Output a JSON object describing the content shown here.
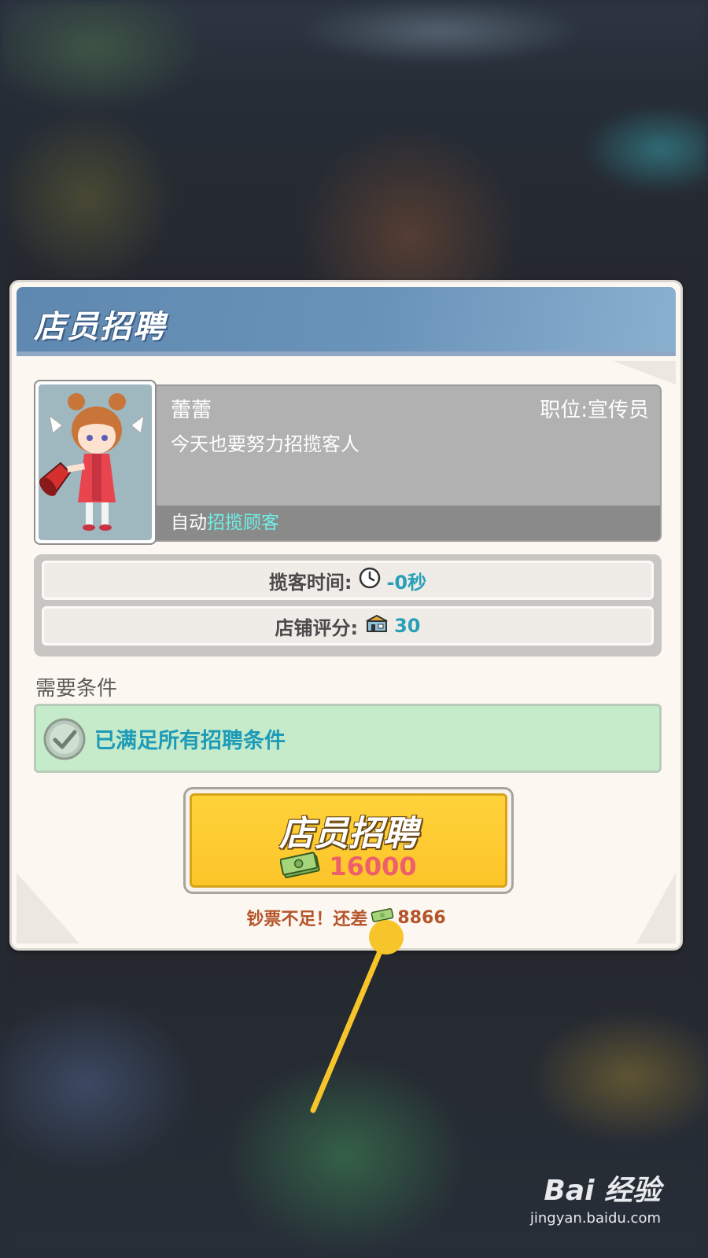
{
  "dialog": {
    "title": "店员招聘"
  },
  "employee": {
    "name": "蕾蕾",
    "position": "职位:宣传员",
    "motto": "今天也要努力招揽客人",
    "skill_prefix": "自动",
    "skill_highlight": "招揽顾客"
  },
  "stats": {
    "solicit_time_label": "揽客时间:",
    "solicit_time_value": "-0秒",
    "solicit_time_icon": "clock-icon",
    "shop_rating_label": "店铺评分:",
    "shop_rating_value": "30",
    "shop_rating_icon": "shop-rating-icon"
  },
  "requirements": {
    "label": "需要条件",
    "status_text": "已满足所有招聘条件"
  },
  "recruit_button": {
    "title": "店员招聘",
    "cost": "16000",
    "cost_icon": "cash-icon"
  },
  "shortage": {
    "prefix": "钞票不足！还差",
    "amount": "8866"
  },
  "watermark": {
    "logo": "Bai 经验",
    "url": "jingyan.baidu.com"
  },
  "colors": {
    "header_blue": "#6a93b9",
    "button_yellow": "#fcc52a",
    "accent_cyan": "#2a9fb8",
    "cost_red": "#ef5f6a",
    "success_green": "#c6ebca",
    "pointer_yellow": "#f7c52a"
  }
}
